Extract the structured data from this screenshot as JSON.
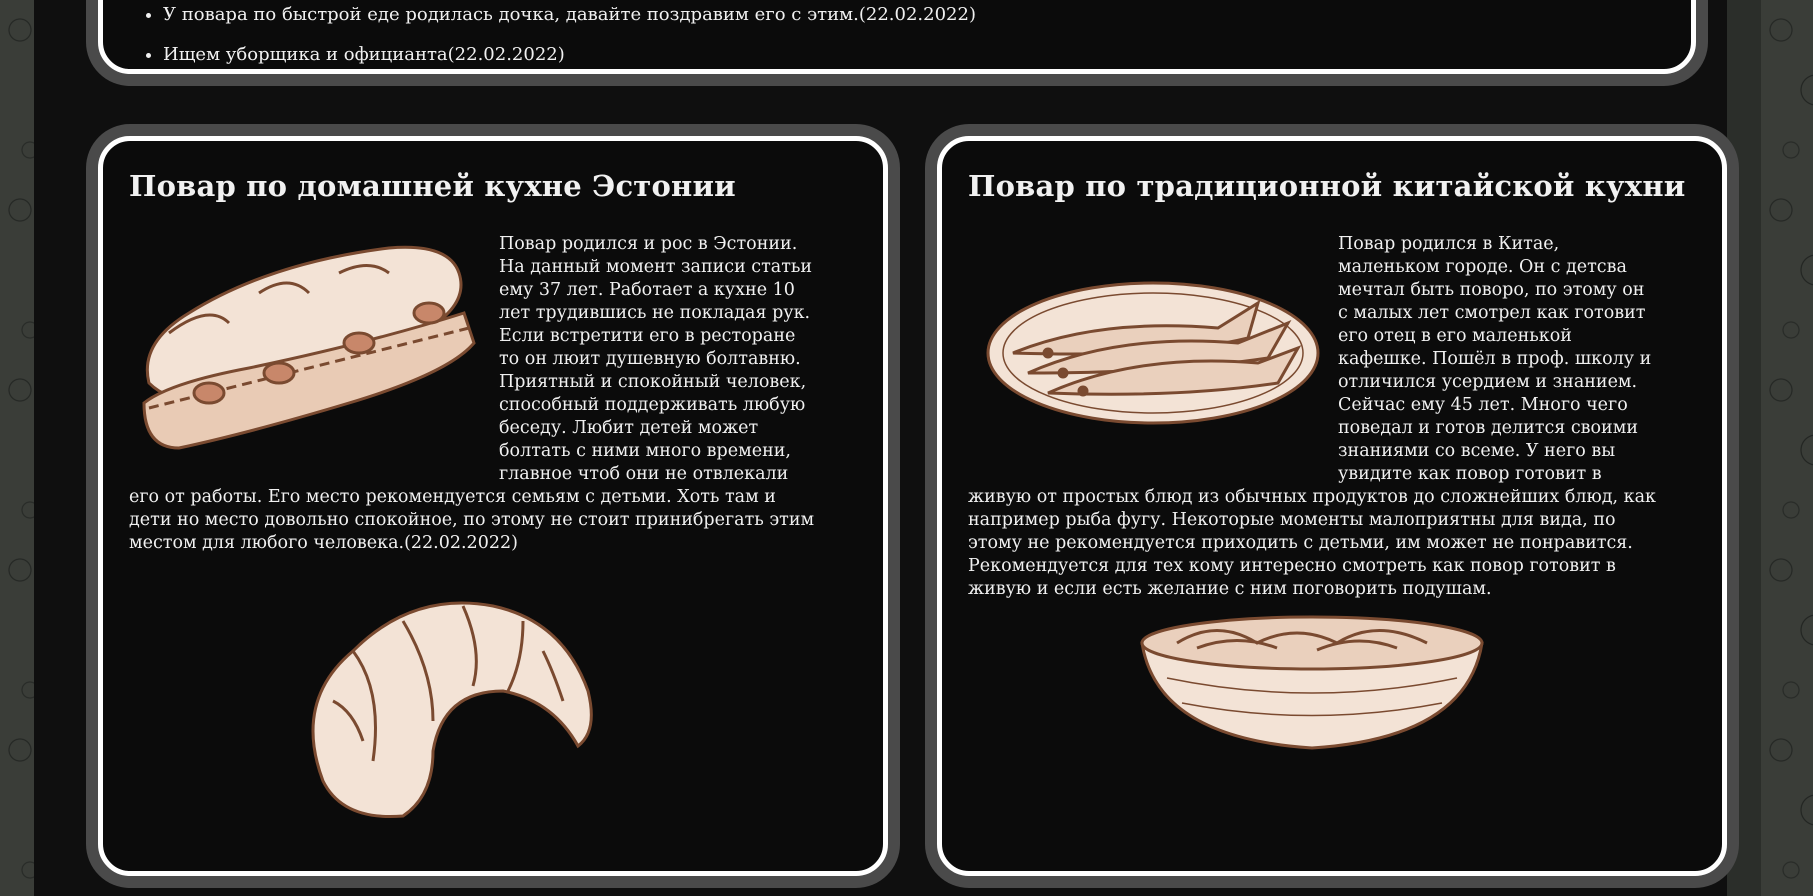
{
  "announcements": {
    "items": [
      "У повара по быстрой еде родилась дочка, давайте поздравим его с этим.(22.02.2022)",
      "Ищем уборщика и официанта(22.02.2022)"
    ]
  },
  "chefs": [
    {
      "title": "Повар по домашней кухне Эстонии",
      "text": "Повар родился и рос в Эстонии. На данный момент записи статьи ему 37 лет. Работает а кухне 10 лет трудившись не покладая рук. Если встретити его в ресторане то он люит душевную болтавню. Приятный и спокойный человек, способный поддерживать любую беседу. Любит детей может болтать с ними много времени, главное чтоб они не отвлекали его от работы. Его место рекомендуется семьям с детьми. Хоть там и дети но место довольно спокойное, по этому не стоит принибрегать этим местом для любого человека.(22.02.2022)",
      "image1": "sandwich-illustration",
      "image2": "croissant-illustration"
    },
    {
      "title": "Повар по традиционной китайской кухни",
      "text": "Повар родился в Китае, маленьком городе. Он с детсва мечтал быть поворо, по этому он с малых лет смотрел как готовит его отец в его маленькой кафешке. Пошёл в проф. школу и отличился усердием и знанием. Сейчас ему 45 лет. Много чего поведал и готов делится своими знаниями со всеме. У него вы увидите как повор готовит в живую от простых блюд из обычных продуктов до сложнейших блюд, как например рыба фугу. Некоторые моменты малоприятны для вида, по этому не рекомендуется приходить с детьми, им может не понравится. Рекомендуется для тех кому интересно смотреть как повор готовит в живую и если есть желание с ним поговорить подушам.",
      "image1": "fish-plate-illustration",
      "image2": "noodle-bowl-illustration"
    }
  ],
  "colors": {
    "card_bg": "#0b0b0b",
    "frame": "#4a4a4a",
    "border": "#ffffff",
    "illustration": "#7a4a30",
    "illustration_fill": "#f3e3d6"
  }
}
